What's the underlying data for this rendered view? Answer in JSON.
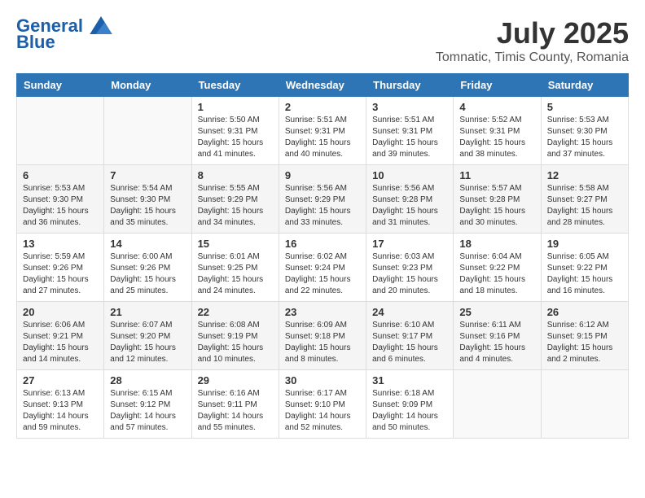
{
  "header": {
    "logo_line1": "General",
    "logo_line2": "Blue",
    "month": "July 2025",
    "location": "Tomnatic, Timis County, Romania"
  },
  "days_of_week": [
    "Sunday",
    "Monday",
    "Tuesday",
    "Wednesday",
    "Thursday",
    "Friday",
    "Saturday"
  ],
  "weeks": [
    [
      {
        "day": "",
        "sunrise": "",
        "sunset": "",
        "daylight": ""
      },
      {
        "day": "",
        "sunrise": "",
        "sunset": "",
        "daylight": ""
      },
      {
        "day": "1",
        "sunrise": "Sunrise: 5:50 AM",
        "sunset": "Sunset: 9:31 PM",
        "daylight": "Daylight: 15 hours and 41 minutes."
      },
      {
        "day": "2",
        "sunrise": "Sunrise: 5:51 AM",
        "sunset": "Sunset: 9:31 PM",
        "daylight": "Daylight: 15 hours and 40 minutes."
      },
      {
        "day": "3",
        "sunrise": "Sunrise: 5:51 AM",
        "sunset": "Sunset: 9:31 PM",
        "daylight": "Daylight: 15 hours and 39 minutes."
      },
      {
        "day": "4",
        "sunrise": "Sunrise: 5:52 AM",
        "sunset": "Sunset: 9:31 PM",
        "daylight": "Daylight: 15 hours and 38 minutes."
      },
      {
        "day": "5",
        "sunrise": "Sunrise: 5:53 AM",
        "sunset": "Sunset: 9:30 PM",
        "daylight": "Daylight: 15 hours and 37 minutes."
      }
    ],
    [
      {
        "day": "6",
        "sunrise": "Sunrise: 5:53 AM",
        "sunset": "Sunset: 9:30 PM",
        "daylight": "Daylight: 15 hours and 36 minutes."
      },
      {
        "day": "7",
        "sunrise": "Sunrise: 5:54 AM",
        "sunset": "Sunset: 9:30 PM",
        "daylight": "Daylight: 15 hours and 35 minutes."
      },
      {
        "day": "8",
        "sunrise": "Sunrise: 5:55 AM",
        "sunset": "Sunset: 9:29 PM",
        "daylight": "Daylight: 15 hours and 34 minutes."
      },
      {
        "day": "9",
        "sunrise": "Sunrise: 5:56 AM",
        "sunset": "Sunset: 9:29 PM",
        "daylight": "Daylight: 15 hours and 33 minutes."
      },
      {
        "day": "10",
        "sunrise": "Sunrise: 5:56 AM",
        "sunset": "Sunset: 9:28 PM",
        "daylight": "Daylight: 15 hours and 31 minutes."
      },
      {
        "day": "11",
        "sunrise": "Sunrise: 5:57 AM",
        "sunset": "Sunset: 9:28 PM",
        "daylight": "Daylight: 15 hours and 30 minutes."
      },
      {
        "day": "12",
        "sunrise": "Sunrise: 5:58 AM",
        "sunset": "Sunset: 9:27 PM",
        "daylight": "Daylight: 15 hours and 28 minutes."
      }
    ],
    [
      {
        "day": "13",
        "sunrise": "Sunrise: 5:59 AM",
        "sunset": "Sunset: 9:26 PM",
        "daylight": "Daylight: 15 hours and 27 minutes."
      },
      {
        "day": "14",
        "sunrise": "Sunrise: 6:00 AM",
        "sunset": "Sunset: 9:26 PM",
        "daylight": "Daylight: 15 hours and 25 minutes."
      },
      {
        "day": "15",
        "sunrise": "Sunrise: 6:01 AM",
        "sunset": "Sunset: 9:25 PM",
        "daylight": "Daylight: 15 hours and 24 minutes."
      },
      {
        "day": "16",
        "sunrise": "Sunrise: 6:02 AM",
        "sunset": "Sunset: 9:24 PM",
        "daylight": "Daylight: 15 hours and 22 minutes."
      },
      {
        "day": "17",
        "sunrise": "Sunrise: 6:03 AM",
        "sunset": "Sunset: 9:23 PM",
        "daylight": "Daylight: 15 hours and 20 minutes."
      },
      {
        "day": "18",
        "sunrise": "Sunrise: 6:04 AM",
        "sunset": "Sunset: 9:22 PM",
        "daylight": "Daylight: 15 hours and 18 minutes."
      },
      {
        "day": "19",
        "sunrise": "Sunrise: 6:05 AM",
        "sunset": "Sunset: 9:22 PM",
        "daylight": "Daylight: 15 hours and 16 minutes."
      }
    ],
    [
      {
        "day": "20",
        "sunrise": "Sunrise: 6:06 AM",
        "sunset": "Sunset: 9:21 PM",
        "daylight": "Daylight: 15 hours and 14 minutes."
      },
      {
        "day": "21",
        "sunrise": "Sunrise: 6:07 AM",
        "sunset": "Sunset: 9:20 PM",
        "daylight": "Daylight: 15 hours and 12 minutes."
      },
      {
        "day": "22",
        "sunrise": "Sunrise: 6:08 AM",
        "sunset": "Sunset: 9:19 PM",
        "daylight": "Daylight: 15 hours and 10 minutes."
      },
      {
        "day": "23",
        "sunrise": "Sunrise: 6:09 AM",
        "sunset": "Sunset: 9:18 PM",
        "daylight": "Daylight: 15 hours and 8 minutes."
      },
      {
        "day": "24",
        "sunrise": "Sunrise: 6:10 AM",
        "sunset": "Sunset: 9:17 PM",
        "daylight": "Daylight: 15 hours and 6 minutes."
      },
      {
        "day": "25",
        "sunrise": "Sunrise: 6:11 AM",
        "sunset": "Sunset: 9:16 PM",
        "daylight": "Daylight: 15 hours and 4 minutes."
      },
      {
        "day": "26",
        "sunrise": "Sunrise: 6:12 AM",
        "sunset": "Sunset: 9:15 PM",
        "daylight": "Daylight: 15 hours and 2 minutes."
      }
    ],
    [
      {
        "day": "27",
        "sunrise": "Sunrise: 6:13 AM",
        "sunset": "Sunset: 9:13 PM",
        "daylight": "Daylight: 14 hours and 59 minutes."
      },
      {
        "day": "28",
        "sunrise": "Sunrise: 6:15 AM",
        "sunset": "Sunset: 9:12 PM",
        "daylight": "Daylight: 14 hours and 57 minutes."
      },
      {
        "day": "29",
        "sunrise": "Sunrise: 6:16 AM",
        "sunset": "Sunset: 9:11 PM",
        "daylight": "Daylight: 14 hours and 55 minutes."
      },
      {
        "day": "30",
        "sunrise": "Sunrise: 6:17 AM",
        "sunset": "Sunset: 9:10 PM",
        "daylight": "Daylight: 14 hours and 52 minutes."
      },
      {
        "day": "31",
        "sunrise": "Sunrise: 6:18 AM",
        "sunset": "Sunset: 9:09 PM",
        "daylight": "Daylight: 14 hours and 50 minutes."
      },
      {
        "day": "",
        "sunrise": "",
        "sunset": "",
        "daylight": ""
      },
      {
        "day": "",
        "sunrise": "",
        "sunset": "",
        "daylight": ""
      }
    ]
  ]
}
